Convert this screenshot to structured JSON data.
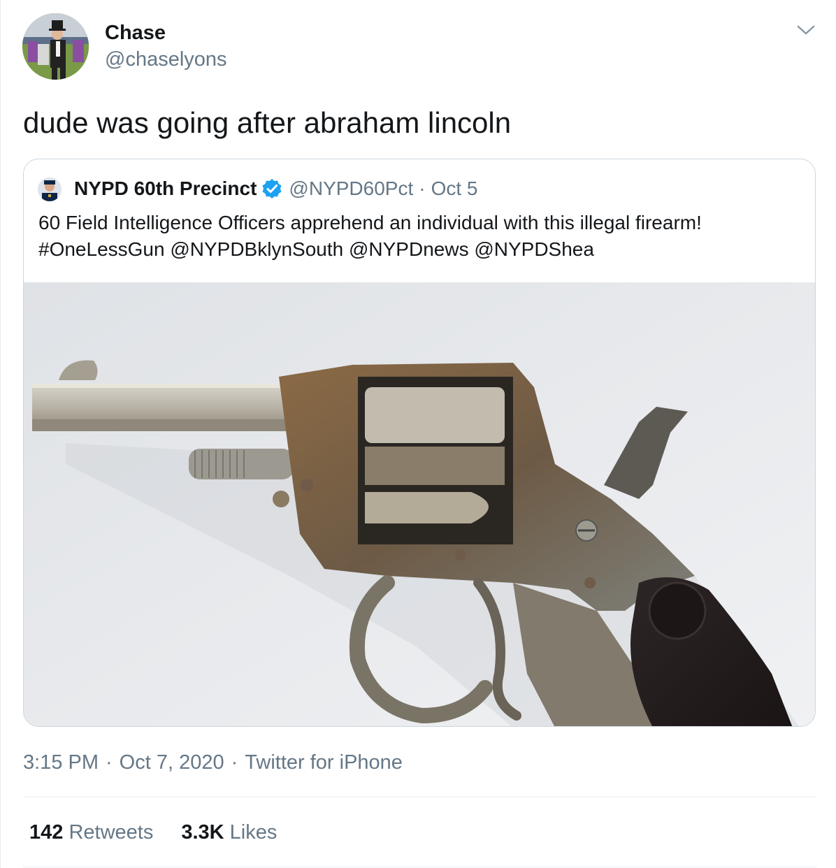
{
  "author": {
    "name": "Chase",
    "handle": "@chaselyons",
    "avatar_icon": "avatar-photo"
  },
  "tweet": {
    "text": "dude was going after abraham lincoln",
    "time": "3:15 PM",
    "date": "Oct 7, 2020",
    "source": "Twitter for iPhone",
    "separator": "·"
  },
  "quoted": {
    "name": "NYPD 60th Precinct",
    "verified_icon": "verified-badge-icon",
    "handle": "@NYPD60Pct",
    "separator": "·",
    "date": "Oct 5",
    "text_line1": "60 Field Intelligence Officers apprehend an individual with this illegal firearm!",
    "text_line2": "#OneLessGun @NYPDBklynSouth @NYPDnews @NYPDShea",
    "image": "revolver-photo"
  },
  "stats": {
    "retweets_count": "142",
    "retweets_label": "Retweets",
    "likes_count": "3.3K",
    "likes_label": "Likes"
  },
  "colors": {
    "text": "#14171a",
    "muted": "#657786",
    "border": "#ccd6dd",
    "verified": "#1da1f2"
  }
}
